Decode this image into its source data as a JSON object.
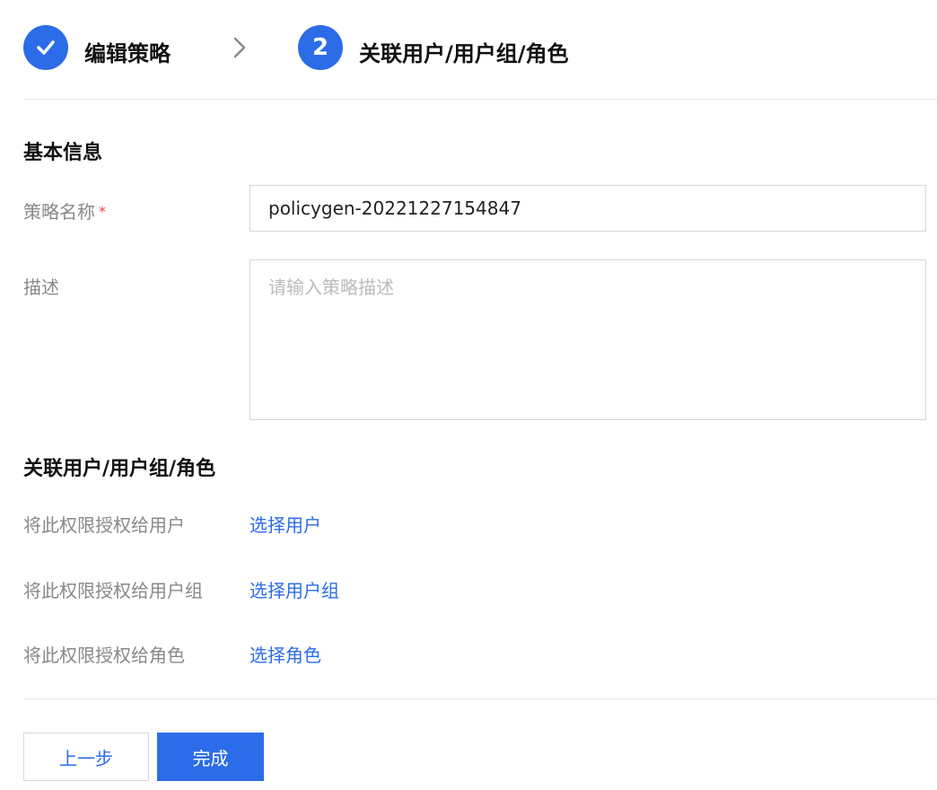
{
  "steps": [
    {
      "status": "completed",
      "icon": "check-icon",
      "title": "编辑策略"
    },
    {
      "status": "current",
      "number": "2",
      "title": "关联用户/用户组/角色"
    }
  ],
  "basic_info": {
    "section_title": "基本信息",
    "policy_name": {
      "label": "策略名称",
      "required_mark": "*",
      "value": "policygen-20221227154847"
    },
    "description": {
      "label": "描述",
      "placeholder": "请输入策略描述",
      "value": ""
    }
  },
  "association": {
    "section_title": "关联用户/用户组/角色",
    "rows": [
      {
        "label": "将此权限授权给用户",
        "link": "选择用户"
      },
      {
        "label": "将此权限授权给用户组",
        "link": "选择用户组"
      },
      {
        "label": "将此权限授权给角色",
        "link": "选择角色"
      }
    ]
  },
  "footer": {
    "prev_label": "上一步",
    "done_label": "完成"
  },
  "colors": {
    "accent": "#2d6ce8",
    "required": "#e54545",
    "label_gray": "#888888",
    "border": "#d7d7d7"
  }
}
